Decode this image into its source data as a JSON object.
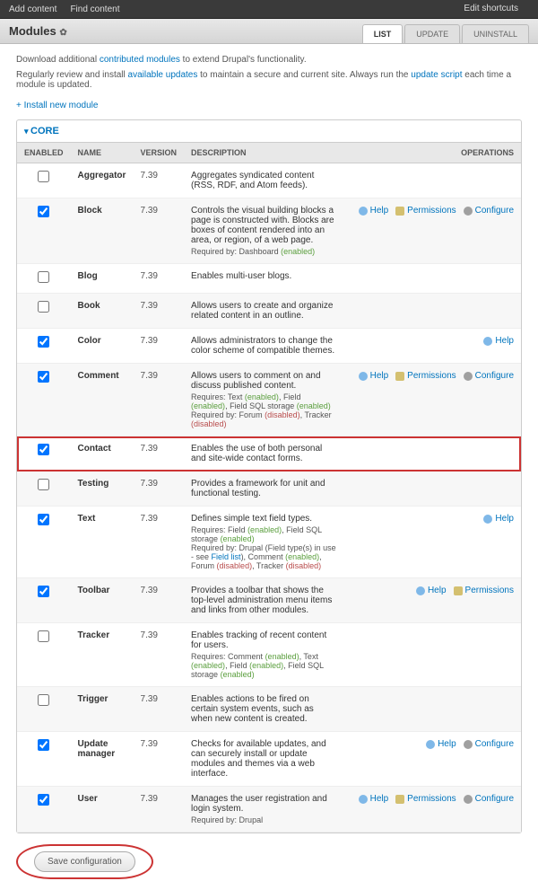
{
  "topbar": {
    "add": "Add content",
    "find": "Find content",
    "edit": "Edit shortcuts"
  },
  "header": {
    "title": "Modules",
    "tabs": {
      "list": "LIST",
      "update": "UPDATE",
      "uninstall": "UNINSTALL"
    }
  },
  "intro": {
    "l1a": "Download additional ",
    "l1b": "contributed modules",
    "l1c": " to extend Drupal's functionality.",
    "l2a": "Regularly review and install ",
    "l2b": "available updates",
    "l2c": " to maintain a secure and current site. Always run the ",
    "l2d": "update script",
    "l2e": " each time a module is updated.",
    "install": "+ Install new module"
  },
  "fieldset": {
    "legend": "CORE"
  },
  "cols": {
    "enabled": "ENABLED",
    "name": "NAME",
    "version": "VERSION",
    "desc": "DESCRIPTION",
    "ops": "OPERATIONS"
  },
  "ops": {
    "help": "Help",
    "perm": "Permissions",
    "conf": "Configure"
  },
  "version": "7.39",
  "rows": [
    {
      "on": false,
      "name": "Aggregator",
      "desc": "Aggregates syndicated content (RSS, RDF, and Atom feeds)."
    },
    {
      "on": true,
      "name": "Block",
      "desc": "Controls the visual building blocks a page is constructed with. Blocks are boxes of content rendered into an area, or region, of a web page.",
      "req": "Required by: Dashboard <e>(enabled)</e>",
      "help": true,
      "perm": true,
      "conf": true
    },
    {
      "on": false,
      "name": "Blog",
      "desc": "Enables multi-user blogs."
    },
    {
      "on": false,
      "name": "Book",
      "desc": "Allows users to create and organize related content in an outline."
    },
    {
      "on": true,
      "name": "Color",
      "desc": "Allows administrators to change the color scheme of compatible themes.",
      "help": true
    },
    {
      "on": true,
      "name": "Comment",
      "desc": "Allows users to comment on and discuss published content.",
      "req": "Requires: Text <e>(enabled)</e>, Field <e>(enabled)</e>, Field SQL storage <e>(enabled)</e><br>Required by: Forum <d>(disabled)</d>, Tracker <d>(disabled)</d>",
      "help": true,
      "perm": true,
      "conf": true
    },
    {
      "on": true,
      "name": "Contact",
      "desc": "Enables the use of both personal and site-wide contact forms.",
      "hl": true
    },
    {
      "on": false,
      "name": "Testing",
      "desc": "Provides a framework for unit and functional testing."
    },
    {
      "on": true,
      "name": "Text",
      "desc": "Defines simple text field types.",
      "req": "Requires: Field <e>(enabled)</e>, Field SQL storage <e>(enabled)</e><br>Required by: Drupal (Field type(s) in use - see <a>Field list</a>), Comment <e>(enabled)</e>, Forum <d>(disabled)</d>, Tracker <d>(disabled)</d>",
      "help": true
    },
    {
      "on": true,
      "name": "Toolbar",
      "desc": "Provides a toolbar that shows the top-level administration menu items and links from other modules.",
      "help": true,
      "perm": true
    },
    {
      "on": false,
      "name": "Tracker",
      "desc": "Enables tracking of recent content for users.",
      "req": "Requires: Comment <e>(enabled)</e>, Text <e>(enabled)</e>, Field <e>(enabled)</e>, Field SQL storage <e>(enabled)</e>"
    },
    {
      "on": false,
      "name": "Trigger",
      "desc": "Enables actions to be fired on certain system events, such as when new content is created."
    },
    {
      "on": true,
      "name": "Update manager",
      "desc": "Checks for available updates, and can securely install or update modules and themes via a web interface.",
      "help": true,
      "conf": true
    },
    {
      "on": true,
      "name": "User",
      "desc": "Manages the user registration and login system.",
      "req": "Required by: Drupal",
      "help": true,
      "perm": true,
      "conf": true
    }
  ],
  "save": "Save configuration"
}
